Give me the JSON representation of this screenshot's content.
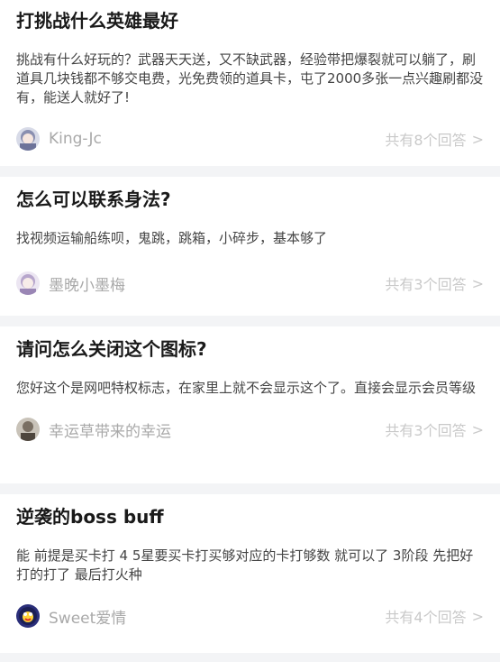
{
  "questions": [
    {
      "title": "打挑战什么英雄最好",
      "answer": "挑战有什么好玩的？武器天天送，又不缺武器，经验带把爆裂就可以躺了，刷道具几块钱都不够交电费，光免费领的道具卡，屯了2000多张一点兴趣刷都没有，能送人就好了!",
      "user": "King-Jc",
      "count": "共有8个回答",
      "avatar_icon": "avatar-anime-girl-icon"
    },
    {
      "title": "怎么可以联系身法?",
      "answer": "找视频运输船练呗，鬼跳，跳箱，小碎步，基本够了",
      "user": "墨晚小墨梅",
      "count": "共有3个回答",
      "avatar_icon": "avatar-anime-lavender-icon"
    },
    {
      "title": "请问怎么关闭这个图标?",
      "answer": "您好这个是网吧特权标志，在家里上就不会显示这个了。直接会显示会员等级",
      "user": "幸运草带来的幸运",
      "count": "共有3个回答",
      "avatar_icon": "avatar-portrait-icon"
    },
    {
      "title": "逆袭的boss buff",
      "answer": "能 前提是买卡打 4 5星要买卡打买够对应的卡打够数 就可以了 3阶段 先把好打的打了 最后打火种",
      "user": "Sweet爱情",
      "count": "共有4个回答",
      "avatar_icon": "avatar-cartoon-penguin-icon"
    }
  ],
  "chevron": ">",
  "colors": {
    "title": "#1a1a1a",
    "answer": "#444444",
    "username": "#a9a9a9",
    "count": "#c9c9c9",
    "page_bg": "#f3f4f6"
  }
}
